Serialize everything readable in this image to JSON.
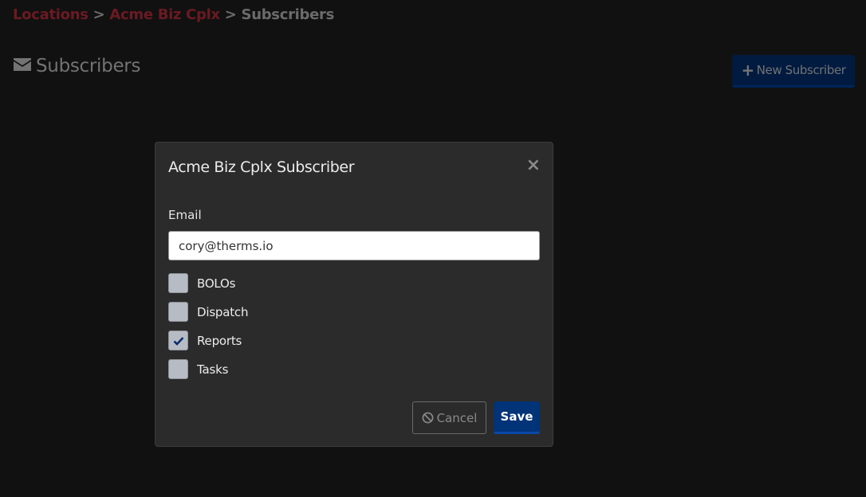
{
  "breadcrumb": {
    "items": [
      "Locations",
      "Acme Biz Cplx",
      "Subscribers"
    ],
    "separator": ">"
  },
  "page": {
    "title": "Subscribers",
    "icon": "envelope-icon"
  },
  "toolbar": {
    "new_subscriber_label": "New Subscriber",
    "new_subscriber_icon": "+"
  },
  "modal": {
    "title": "Acme Biz Cplx Subscriber",
    "close_glyph": "×",
    "email_label": "Email",
    "email_value": "cory@therms.io",
    "checkboxes": [
      {
        "label": "BOLOs",
        "checked": false
      },
      {
        "label": "Dispatch",
        "checked": false
      },
      {
        "label": "Reports",
        "checked": true
      },
      {
        "label": "Tasks",
        "checked": false
      }
    ],
    "cancel_label": "Cancel",
    "save_label": "Save"
  },
  "colors": {
    "link": "#6b1a22",
    "primary": "#003377",
    "background": "#111111",
    "modal_bg": "#2b2b2b"
  }
}
